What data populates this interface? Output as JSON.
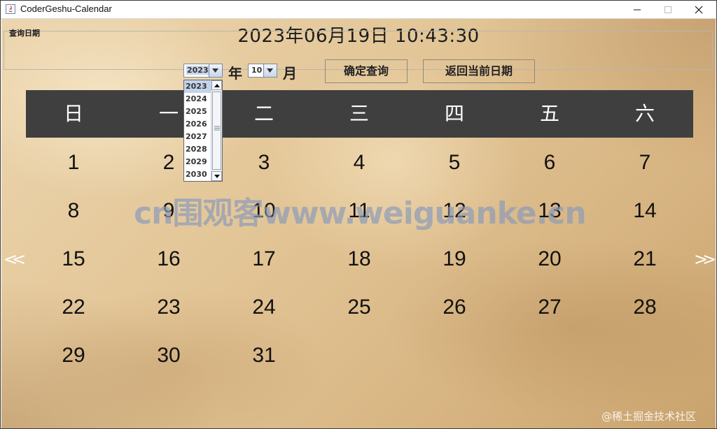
{
  "window": {
    "title": "CoderGeshu-Calendar",
    "controls": {
      "minimize": "minimize-icon",
      "maximize": "maximize-icon",
      "close": "close-icon"
    }
  },
  "clock": {
    "datetime": "2023年06月19日 10:43:30"
  },
  "query": {
    "group_title": "查询日期",
    "year_value": "2023",
    "year_label": "年",
    "month_value": "10",
    "month_label": "月",
    "confirm_button": "确定查询",
    "today_button": "返回当前日期",
    "year_options": [
      "2023",
      "2024",
      "2025",
      "2026",
      "2027",
      "2028",
      "2029",
      "2030"
    ]
  },
  "calendar": {
    "weekdays": [
      "日",
      "一",
      "二",
      "三",
      "四",
      "五",
      "六"
    ],
    "days": [
      "1",
      "2",
      "3",
      "4",
      "5",
      "6",
      "7",
      "8",
      "9",
      "10",
      "11",
      "12",
      "13",
      "14",
      "15",
      "16",
      "17",
      "18",
      "19",
      "20",
      "21",
      "22",
      "23",
      "24",
      "25",
      "26",
      "27",
      "28",
      "29",
      "30",
      "31"
    ],
    "prev_label": "<<",
    "next_label": ">>"
  },
  "overlay": {
    "watermark": "cn围观客www.weiguanke.cn",
    "source": "@稀土掘金技术社区"
  }
}
